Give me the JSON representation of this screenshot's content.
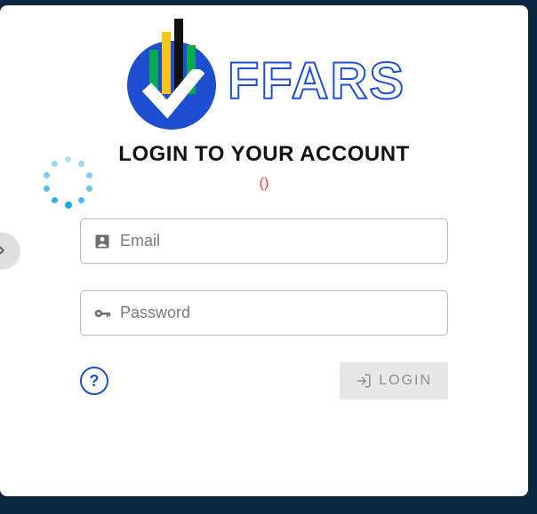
{
  "brand": "FFARS",
  "heading": "LOGIN TO YOUR ACCOUNT",
  "error": "()",
  "email": {
    "placeholder": "Email",
    "value": ""
  },
  "password": {
    "placeholder": "Password",
    "value": ""
  },
  "help_label": "?",
  "login_label": "LOGIN"
}
